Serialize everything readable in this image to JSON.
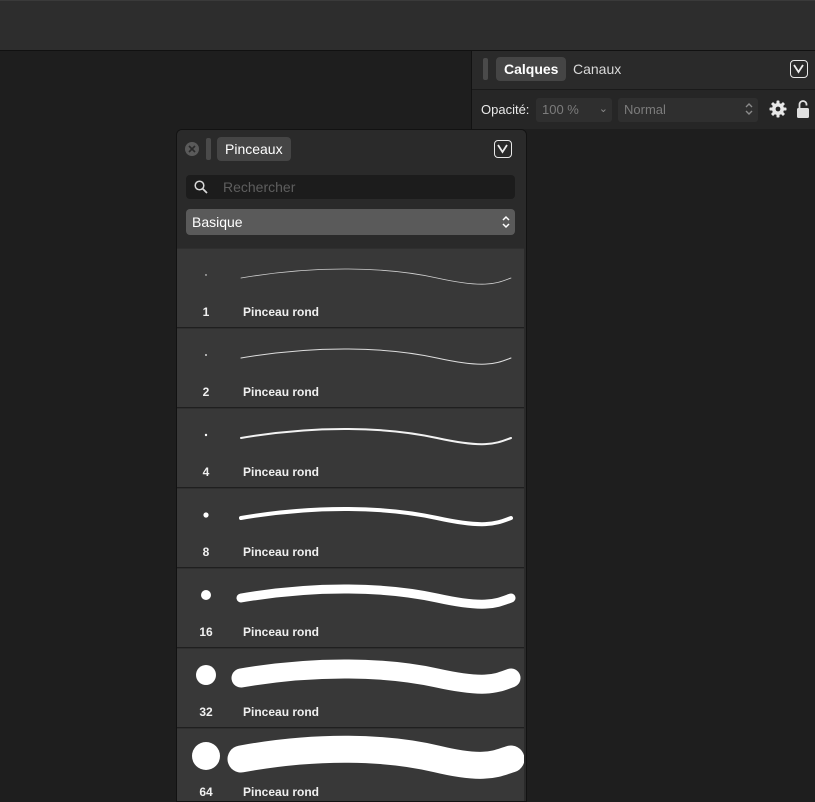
{
  "layers_panel": {
    "tabs": [
      {
        "label": "Calques",
        "active": true
      },
      {
        "label": "Canaux",
        "active": false
      }
    ],
    "opacity_label": "Opacité:",
    "opacity_value": "100 %",
    "blend_mode": "Normal"
  },
  "brushes_panel": {
    "tab_label": "Pinceaux",
    "search_placeholder": "Rechercher",
    "category": "Basique",
    "brushes": [
      {
        "size": "1",
        "name": "Pinceau rond"
      },
      {
        "size": "2",
        "name": "Pinceau rond"
      },
      {
        "size": "4",
        "name": "Pinceau rond"
      },
      {
        "size": "8",
        "name": "Pinceau rond"
      },
      {
        "size": "16",
        "name": "Pinceau rond"
      },
      {
        "size": "32",
        "name": "Pinceau rond"
      },
      {
        "size": "64",
        "name": "Pinceau rond"
      }
    ]
  },
  "icons": {
    "close": "close-icon",
    "collapse": "chevron-down-icon",
    "search": "search-icon",
    "gear": "gear-icon",
    "lock": "lock-icon"
  }
}
